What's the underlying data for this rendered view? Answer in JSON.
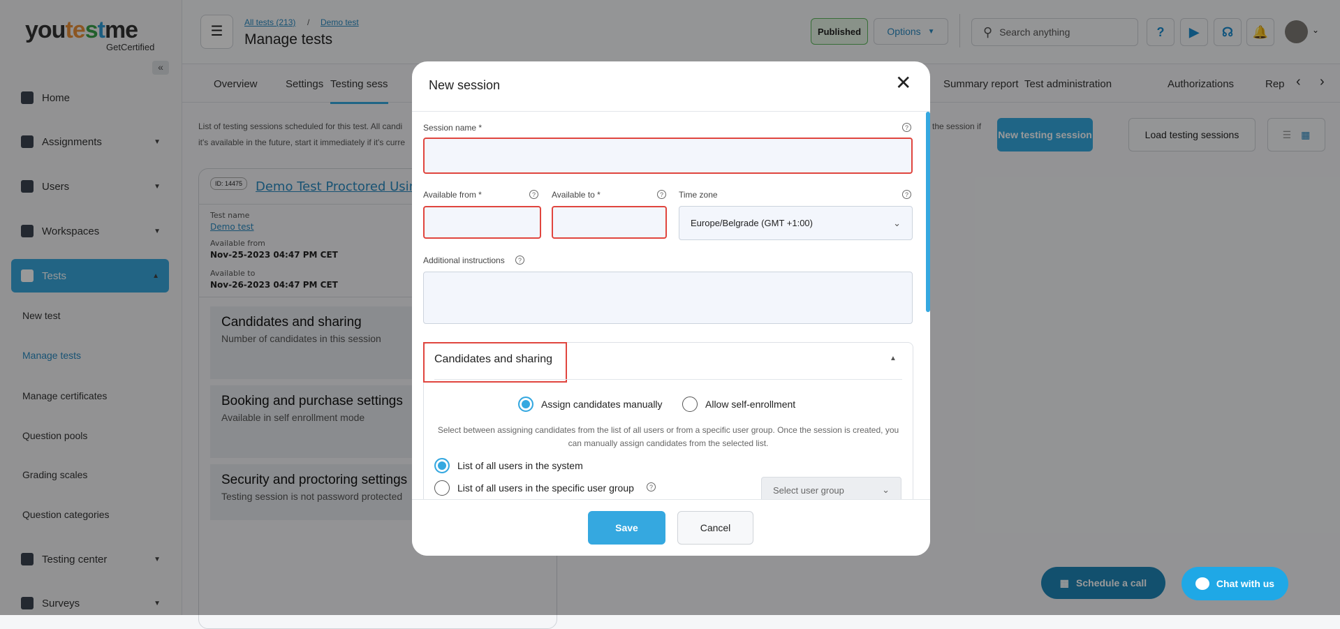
{
  "brand": {
    "name_a": "you",
    "name_b": "t",
    "name_c": "e",
    "name_d": "s",
    "name_e": "t",
    "name_f": "me",
    "tagline": "GetCertified"
  },
  "sidebar": {
    "collapse": "«",
    "items": [
      {
        "label": "Home"
      },
      {
        "label": "Assignments"
      },
      {
        "label": "Users"
      },
      {
        "label": "Workspaces"
      },
      {
        "label": "Tests"
      },
      {
        "label": "New test"
      },
      {
        "label": "Manage tests"
      },
      {
        "label": "Manage certificates"
      },
      {
        "label": "Question pools"
      },
      {
        "label": "Grading scales"
      },
      {
        "label": "Question categories"
      },
      {
        "label": "Testing center"
      },
      {
        "label": "Surveys"
      }
    ]
  },
  "header": {
    "breadcrumb": [
      "All tests (213)",
      "Demo test"
    ],
    "separator": "/",
    "title": "Manage tests",
    "status": "Published",
    "options": "Options",
    "search_placeholder": "Search anything"
  },
  "tabs": [
    "Overview",
    "Settings",
    "Testing sess",
    "Summary report",
    "Test administration",
    "Authorizations",
    "Rep"
  ],
  "page": {
    "description_1": "List of testing sessions scheduled for this test. All candi",
    "description_2": "it's available in the future, start it immediately if it's curre",
    "description_right": "the session if",
    "new_session": "New testing session",
    "load_sessions": "Load testing sessions"
  },
  "card": {
    "id": "ID: 14475",
    "title": "Demo Test Proctored Using",
    "test_name_label": "Test name",
    "test_name": "Demo test",
    "from_label": "Available from",
    "from": "Nov-25-2023 04:47 PM CET",
    "to_label": "Available to",
    "to": "Nov-26-2023 04:47 PM CET",
    "panels": [
      {
        "title": "Candidates and sharing",
        "text": "Number of candidates in this session"
      },
      {
        "title": "Booking and purchase settings",
        "text": "Available in self enrollment mode"
      },
      {
        "title": "Security and proctoring settings",
        "text": "Testing session is not password protected"
      }
    ]
  },
  "modal": {
    "title": "New session",
    "session_name_label": "Session name *",
    "session_name": "",
    "from_label": "Available from *",
    "from": "",
    "to_label": "Available to *",
    "to": "",
    "tz_label": "Time zone",
    "tz": "Europe/Belgrade (GMT +1:00)",
    "instructions_label": "Additional instructions",
    "instructions": "",
    "section": "Candidates and sharing",
    "assign_manual": "Assign candidates manually",
    "self_enroll": "Allow self-enrollment",
    "help": "Select between assigning candidates from the list of all users or from a specific user group. Once the session is created, you can manually assign candidates from the selected list.",
    "all_users": "List of all users in the system",
    "group_users": "List of all users in the specific user group",
    "group_placeholder": "Select user group",
    "save": "Save",
    "cancel": "Cancel"
  },
  "widgets": {
    "schedule": "Schedule a call",
    "chat": "Chat with us"
  },
  "colors": {
    "accent": "#35a8e0",
    "highlight": "#e0453e"
  }
}
